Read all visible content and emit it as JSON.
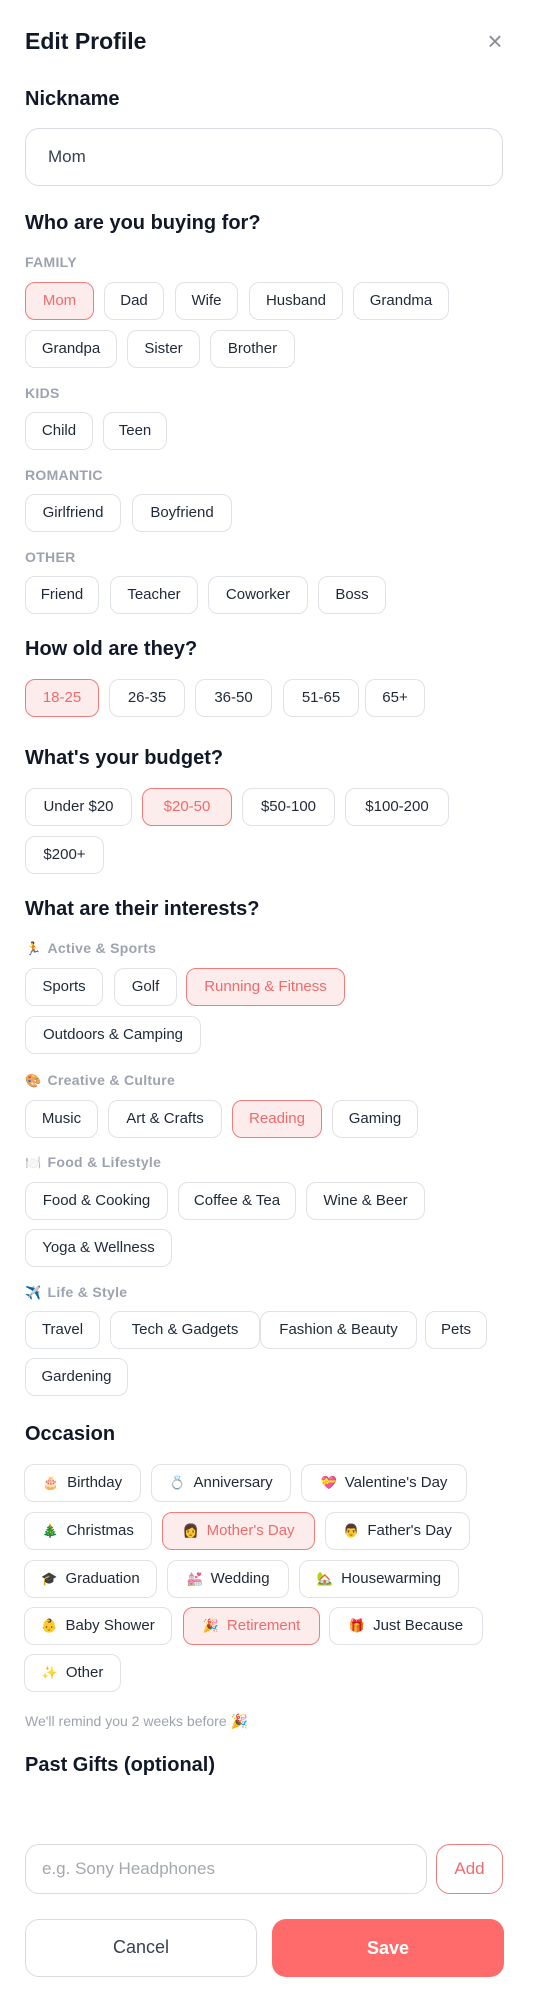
{
  "header": {
    "title": "Edit Profile",
    "close_icon": "×"
  },
  "nickname": {
    "label": "Nickname",
    "value": "Mom"
  },
  "recipient": {
    "title": "Who are you buying for?",
    "groups": {
      "family": {
        "label": "FAMILY",
        "options": [
          "Mom",
          "Dad",
          "Wife",
          "Husband",
          "Grandma",
          "Grandpa",
          "Sister",
          "Brother"
        ]
      },
      "kids": {
        "label": "KIDS",
        "options": [
          "Child",
          "Teen"
        ]
      },
      "romantic": {
        "label": "ROMANTIC",
        "options": [
          "Girlfriend",
          "Boyfriend"
        ]
      },
      "other": {
        "label": "OTHER",
        "options": [
          "Friend",
          "Teacher",
          "Coworker",
          "Boss"
        ]
      }
    },
    "selected": "Mom"
  },
  "age": {
    "title": "How old are they?",
    "options": [
      "18-25",
      "26-35",
      "36-50",
      "51-65",
      "65+"
    ],
    "selected": "18-25"
  },
  "budget": {
    "title": "What's your budget?",
    "options": [
      "Under $20",
      "$20-50",
      "$50-100",
      "$100-200",
      "$200+"
    ],
    "selected": "$20-50"
  },
  "interests": {
    "title": "What are their interests?",
    "groups": {
      "active": {
        "icon": "🏃",
        "label": "Active & Sports",
        "options": [
          "Sports",
          "Golf",
          "Running & Fitness",
          "Outdoors & Camping"
        ]
      },
      "creative": {
        "icon": "🎨",
        "label": "Creative & Culture",
        "options": [
          "Music",
          "Art & Crafts",
          "Reading",
          "Gaming"
        ]
      },
      "food": {
        "icon": "🍽️",
        "label": "Food & Lifestyle",
        "options": [
          "Food & Cooking",
          "Coffee & Tea",
          "Wine & Beer",
          "Yoga & Wellness"
        ]
      },
      "life": {
        "icon": "✈️",
        "label": "Life & Style",
        "options": [
          "Travel",
          "Tech & Gadgets",
          "Fashion & Beauty",
          "Pets",
          "Gardening"
        ]
      }
    },
    "selected": [
      "Running & Fitness",
      "Reading"
    ]
  },
  "occasion": {
    "title": "Occasion",
    "options": [
      {
        "icon": "🎂",
        "label": "Birthday"
      },
      {
        "icon": "💍",
        "label": "Anniversary"
      },
      {
        "icon": "💝",
        "label": "Valentine's Day"
      },
      {
        "icon": "🎄",
        "label": "Christmas"
      },
      {
        "icon": "👩",
        "label": "Mother's Day"
      },
      {
        "icon": "👨",
        "label": "Father's Day"
      },
      {
        "icon": "🎓",
        "label": "Graduation"
      },
      {
        "icon": "💒",
        "label": "Wedding"
      },
      {
        "icon": "🏡",
        "label": "Housewarming"
      },
      {
        "icon": "👶",
        "label": "Baby Shower"
      },
      {
        "icon": "🎉",
        "label": "Retirement"
      },
      {
        "icon": "🎁",
        "label": "Just Because"
      },
      {
        "icon": "✨",
        "label": "Other"
      }
    ],
    "selected": [
      "Mother's Day",
      "Retirement"
    ],
    "reminder_note": "We'll remind you 2 weeks before 🎉"
  },
  "past_gifts": {
    "title": "Past Gifts (optional)",
    "placeholder": "e.g. Sony Headphones",
    "add_label": "Add"
  },
  "actions": {
    "cancel_label": "Cancel",
    "save_label": "Save"
  },
  "colors": {
    "accent": "#ff6b6b",
    "selected_bg": "#fdecec",
    "selected_text": "#ef6b6b",
    "chip_border": "#dfe2e6",
    "muted": "#9ca3af"
  }
}
